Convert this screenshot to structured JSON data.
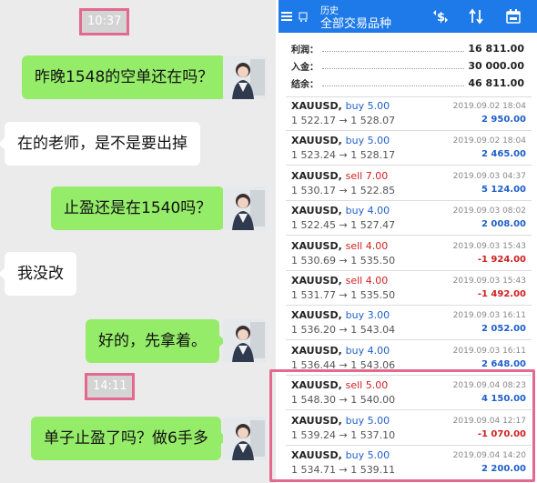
{
  "chat": {
    "timestamps": [
      "10:37",
      "14:11"
    ],
    "messages": [
      {
        "side": "me",
        "text": "昨晚1548的空单还在吗？"
      },
      {
        "side": "them",
        "text": "在的老师，是不是要出掉"
      },
      {
        "side": "me",
        "text": "止盈还是在1540吗？"
      },
      {
        "side": "them",
        "text": "我没改"
      },
      {
        "side": "me",
        "text": "好的，先拿着。"
      },
      {
        "side": "me",
        "text": "单子止盈了吗？做6手多"
      }
    ]
  },
  "history": {
    "header": {
      "title_small": "历史",
      "title": "全部交易品种"
    },
    "icons": [
      "menu-icon",
      "trade-icon",
      "dollar-swap-icon",
      "sort-icon",
      "calendar-icon"
    ],
    "summary": [
      {
        "label": "利润：",
        "value": "16 811.00"
      },
      {
        "label": "入金：",
        "value": "30 000.00"
      },
      {
        "label": "结余：",
        "value": "46 811.00"
      }
    ],
    "trades": [
      {
        "symbol": "XAUUSD,",
        "side": "buy 5.00",
        "type": "buy",
        "prices": "1 522.17 → 1 528.07",
        "date": "2019.09.02 18:04",
        "profit": "2 950.00",
        "pl": "pos"
      },
      {
        "symbol": "XAUUSD,",
        "side": "buy 5.00",
        "type": "buy",
        "prices": "1 523.24 → 1 528.17",
        "date": "2019.09.02 18:04",
        "profit": "2 465.00",
        "pl": "pos"
      },
      {
        "symbol": "XAUUSD,",
        "side": "sell 7.00",
        "type": "sell",
        "prices": "1 530.17 → 1 522.85",
        "date": "2019.09.03 04:37",
        "profit": "5 124.00",
        "pl": "pos"
      },
      {
        "symbol": "XAUUSD,",
        "side": "buy 4.00",
        "type": "buy",
        "prices": "1 522.45 → 1 527.47",
        "date": "2019.09.03 08:02",
        "profit": "2 008.00",
        "pl": "pos"
      },
      {
        "symbol": "XAUUSD,",
        "side": "sell 4.00",
        "type": "sell",
        "prices": "1 530.69 → 1 535.50",
        "date": "2019.09.03 15:43",
        "profit": "-1 924.00",
        "pl": "neg"
      },
      {
        "symbol": "XAUUSD,",
        "side": "sell 4.00",
        "type": "sell",
        "prices": "1 531.77 → 1 535.50",
        "date": "2019.09.03 15:43",
        "profit": "-1 492.00",
        "pl": "neg"
      },
      {
        "symbol": "XAUUSD,",
        "side": "buy 3.00",
        "type": "buy",
        "prices": "1 536.20 → 1 543.04",
        "date": "2019.09.03 16:11",
        "profit": "2 052.00",
        "pl": "pos"
      },
      {
        "symbol": "XAUUSD,",
        "side": "buy 4.00",
        "type": "buy",
        "prices": "1 536.44 → 1 543.06",
        "date": "2019.09.03 16:11",
        "profit": "2 648.00",
        "pl": "pos"
      },
      {
        "symbol": "XAUUSD,",
        "side": "sell 5.00",
        "type": "sell",
        "prices": "1 548.30 → 1 540.00",
        "date": "2019.09.04 08:23",
        "profit": "4 150.00",
        "pl": "pos"
      },
      {
        "symbol": "XAUUSD,",
        "side": "buy 5.00",
        "type": "buy",
        "prices": "1 539.24 → 1 537.10",
        "date": "2019.09.04 12:17",
        "profit": "-1 070.00",
        "pl": "neg"
      },
      {
        "symbol": "XAUUSD,",
        "side": "buy 5.00",
        "type": "buy",
        "prices": "1 534.71 → 1 539.11",
        "date": "2019.09.04 14:20",
        "profit": "2 200.00",
        "pl": "pos"
      }
    ]
  },
  "colors": {
    "me_bubble": "#95ec69",
    "header_blue": "#1e7ae8",
    "highlight": "#e36a8e",
    "buy": "#1e5fc9",
    "sell": "#d01f1f"
  }
}
